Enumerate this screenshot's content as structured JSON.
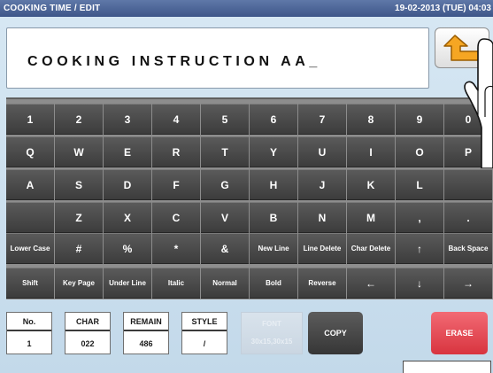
{
  "header": {
    "title": "COOKING TIME / EDIT",
    "datetime": "19-02-2013 (TUE) 04:03"
  },
  "editor": {
    "text": "COOKING INSTRUCTION AA_"
  },
  "enter_button": {
    "icon": "return-arrow-icon",
    "color": "#f5a623"
  },
  "keyboard": {
    "rows": [
      [
        "1",
        "2",
        "3",
        "4",
        "5",
        "6",
        "7",
        "8",
        "9",
        "0"
      ],
      [
        "Q",
        "W",
        "E",
        "R",
        "T",
        "Y",
        "U",
        "I",
        "O",
        "P"
      ],
      [
        "A",
        "S",
        "D",
        "F",
        "G",
        "H",
        "J",
        "K",
        "L",
        ""
      ],
      [
        "",
        "Z",
        "X",
        "C",
        "V",
        "B",
        "N",
        "M",
        ",",
        "."
      ],
      [
        "Lower Case",
        "#",
        "%",
        "*",
        "&",
        "New Line",
        "Line Delete",
        "Char Delete",
        "↑",
        "Back Space"
      ],
      [
        "Shift",
        "Key Page",
        "Under Line",
        "Italic",
        "Normal",
        "Bold",
        "Reverse",
        "←",
        "↓",
        "→"
      ]
    ]
  },
  "status": {
    "no": {
      "label": "No.",
      "value": "1"
    },
    "char": {
      "label": "CHAR",
      "value": "022"
    },
    "remain": {
      "label": "REMAIN",
      "value": "486"
    },
    "style": {
      "label": "STYLE",
      "value": "/"
    }
  },
  "font_button": {
    "label": "FONT",
    "value": "30x15,30x15"
  },
  "copy_button": {
    "label": "COPY"
  },
  "erase_button": {
    "label": "ERASE",
    "color": "#e04650"
  },
  "colors": {
    "titlebar": "#4a6496",
    "background": "#cfe2f0",
    "key": "#4a4a4a"
  }
}
